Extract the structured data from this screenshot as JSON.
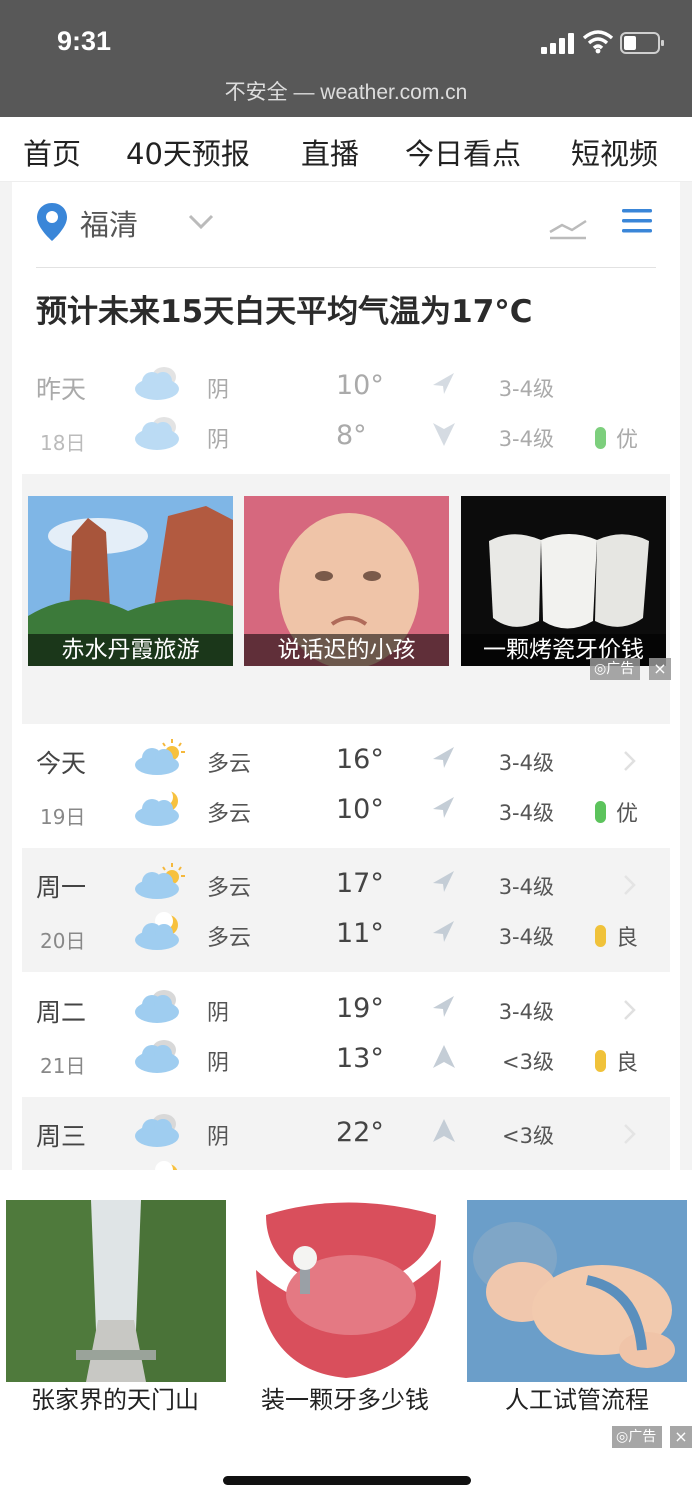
{
  "status_bar": {
    "time": "9:31",
    "url": "不安全 — weather.com.cn"
  },
  "nav": {
    "items": [
      {
        "label": "首页"
      },
      {
        "label": "40天预报"
      },
      {
        "label": "直播"
      },
      {
        "label": "今日看点"
      },
      {
        "label": "短视频"
      }
    ]
  },
  "location": {
    "city": "福清"
  },
  "headline": "预计未来15天白天平均气温为17°C",
  "colors": {
    "accent": "#3a86d8",
    "aqi_good": "#5cc35c",
    "aqi_fair": "#f0c23a",
    "shade": "#f3f3f3"
  },
  "icons": [
    "location-pin-icon",
    "chevron-down-icon",
    "trend-chart-icon",
    "menu-icon",
    "cloudy-icon",
    "partly-cloudy-icon",
    "partly-cloudy-night-icon",
    "wind-direction-icon",
    "chevron-right-icon"
  ],
  "forecast": [
    {
      "day": "昨天",
      "date": "18日",
      "day_cond": "阴",
      "night_cond": "阴",
      "high": "10°",
      "low": "8°",
      "wind_day": "3-4级",
      "wind_night": "3-4级",
      "aqi": "优",
      "aqi_color": "#5cc35c"
    },
    {
      "day": "今天",
      "date": "19日",
      "day_cond": "多云",
      "night_cond": "多云",
      "high": "16°",
      "low": "10°",
      "wind_day": "3-4级",
      "wind_night": "3-4级",
      "aqi": "优",
      "aqi_color": "#5cc35c"
    },
    {
      "day": "周一",
      "date": "20日",
      "day_cond": "多云",
      "night_cond": "多云",
      "high": "17°",
      "low": "11°",
      "wind_day": "3-4级",
      "wind_night": "3-4级",
      "aqi": "良",
      "aqi_color": "#f0c23a"
    },
    {
      "day": "周二",
      "date": "21日",
      "day_cond": "阴",
      "night_cond": "阴",
      "high": "19°",
      "low": "13°",
      "wind_day": "3-4级",
      "wind_night": "<3级",
      "aqi": "良",
      "aqi_color": "#f0c23a"
    },
    {
      "day": "周三",
      "day_cond": "阴",
      "high": "22°",
      "wind_day": "<3级"
    }
  ],
  "ads": {
    "label": "广告",
    "close": "×",
    "inline": [
      {
        "caption": "赤水丹霞旅游"
      },
      {
        "caption": "说话迟的小孩"
      },
      {
        "caption": "一颗烤瓷牙价钱"
      }
    ],
    "bottom": [
      {
        "caption": "张家界的天门山"
      },
      {
        "caption": "装一颗牙多少钱"
      },
      {
        "caption": "人工试管流程"
      }
    ]
  }
}
